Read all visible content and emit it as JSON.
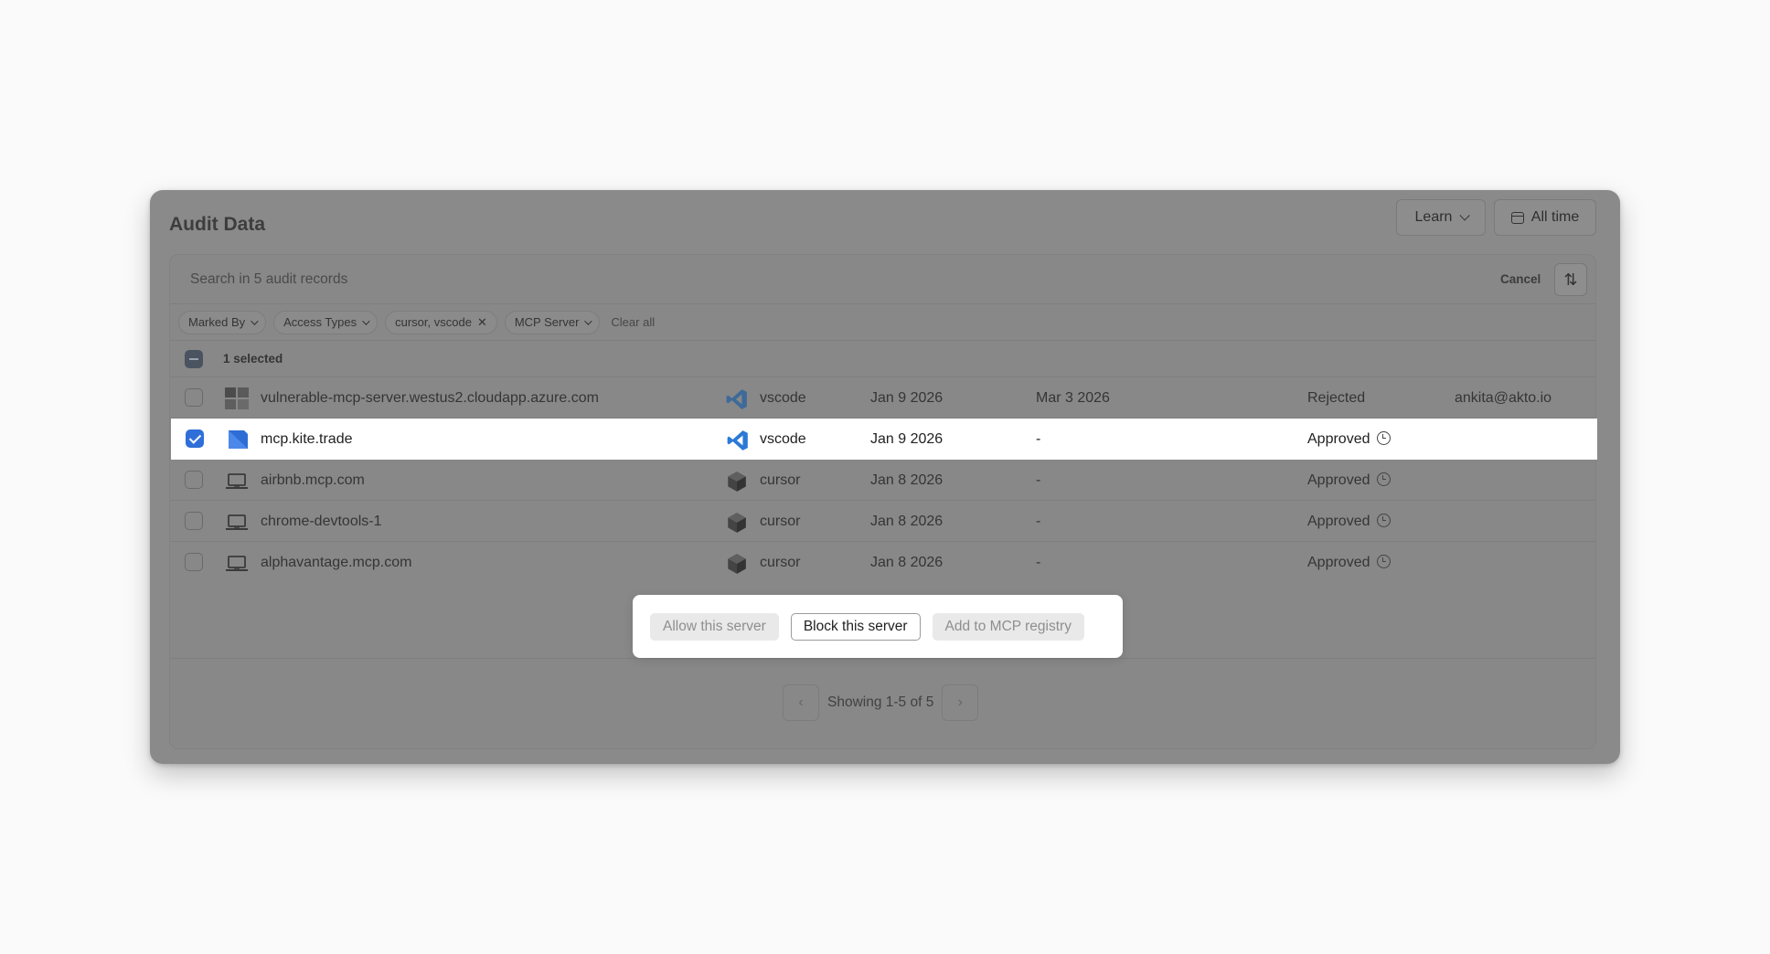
{
  "header": {
    "title": "Audit Data",
    "learn_label": "Learn",
    "time_label": "All time"
  },
  "search": {
    "placeholder": "Search in 5 audit records",
    "cancel_label": "Cancel"
  },
  "filters": {
    "chips": [
      {
        "label": "Marked By",
        "type": "dropdown"
      },
      {
        "label": "Access Types",
        "type": "dropdown"
      },
      {
        "label": "cursor, vscode",
        "type": "removable"
      },
      {
        "label": "MCP Server",
        "type": "dropdown"
      }
    ],
    "clear_all": "Clear all"
  },
  "selection": {
    "label": "1 selected"
  },
  "rows": [
    {
      "server": "vulnerable-mcp-server.westus2.cloudapp.azure.com",
      "server_icon": "azure-grid-icon",
      "client": "vscode",
      "client_icon": "vscode-icon",
      "first_seen": "Jan 9 2026",
      "updated": "Mar 3 2026",
      "status": "Rejected",
      "marked_by": "ankita@akto.io",
      "checked": false
    },
    {
      "server": "mcp.kite.trade",
      "server_icon": "kite-icon",
      "client": "vscode",
      "client_icon": "vscode-icon",
      "first_seen": "Jan 9 2026",
      "updated": "-",
      "status": "Approved",
      "marked_by": "",
      "checked": true
    },
    {
      "server": "airbnb.mcp.com",
      "server_icon": "laptop-icon",
      "client": "cursor",
      "client_icon": "cursor-icon",
      "first_seen": "Jan 8 2026",
      "updated": "-",
      "status": "Approved",
      "marked_by": "",
      "checked": false
    },
    {
      "server": "chrome-devtools-1",
      "server_icon": "laptop-icon",
      "client": "cursor",
      "client_icon": "cursor-icon",
      "first_seen": "Jan 8 2026",
      "updated": "-",
      "status": "Approved",
      "marked_by": "",
      "checked": false
    },
    {
      "server": "alphavantage.mcp.com",
      "server_icon": "laptop-icon",
      "client": "cursor",
      "client_icon": "cursor-icon",
      "first_seen": "Jan 8 2026",
      "updated": "-",
      "status": "Approved",
      "marked_by": "",
      "checked": false
    }
  ],
  "actions": {
    "allow": "Allow this server",
    "block": "Block this server",
    "registry": "Add to MCP registry"
  },
  "pagination": {
    "text": "Showing 1-5 of 5"
  },
  "colors": {
    "accent": "#2f6fd8",
    "overlay": "#8a8a8a"
  }
}
